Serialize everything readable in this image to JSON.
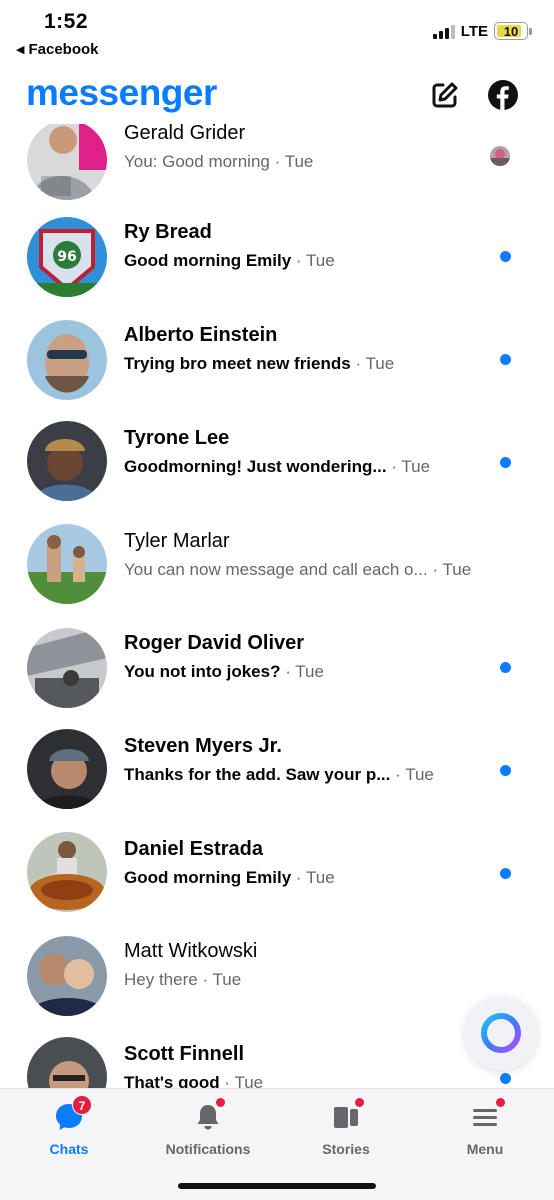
{
  "status_bar": {
    "time": "1:52",
    "back_label": "Facebook",
    "network": "LTE",
    "battery": "10",
    "signal_bars": 3,
    "battery_level_percent": 10
  },
  "header": {
    "title": "messenger",
    "compose_icon": "compose-icon",
    "facebook_icon": "facebook-icon"
  },
  "colors": {
    "accent": "#0a7cff",
    "unread_dot": "#0a7cff",
    "badge": "#e41e3f",
    "secondary_text": "#65676b"
  },
  "chats": [
    {
      "name": "Gerald Grider",
      "message": "You: Good morning",
      "time": "Tue",
      "unread": false,
      "indicator": "seen-avatar"
    },
    {
      "name": "Ry Bread",
      "message": "Good morning Emily",
      "time": "Tue",
      "unread": true,
      "indicator": "unread-dot"
    },
    {
      "name": "Alberto Einstein",
      "message": "Trying bro meet new friends",
      "time": "Tue",
      "unread": true,
      "indicator": "unread-dot"
    },
    {
      "name": "Tyrone Lee",
      "message": "Goodmorning! Just wondering...",
      "time": "Tue",
      "unread": true,
      "indicator": "unread-dot"
    },
    {
      "name": "Tyler Marlar",
      "message": "You can now message and call each o...",
      "time": "Tue",
      "unread": false,
      "indicator": "none"
    },
    {
      "name": "Roger David Oliver",
      "message": "You not into jokes?",
      "time": "Tue",
      "unread": true,
      "indicator": "unread-dot"
    },
    {
      "name": "Steven Myers Jr.",
      "message": "Thanks for the add. Saw your p...",
      "time": "Tue",
      "unread": true,
      "indicator": "unread-dot"
    },
    {
      "name": "Daniel Estrada",
      "message": "Good morning Emily",
      "time": "Tue",
      "unread": true,
      "indicator": "unread-dot"
    },
    {
      "name": "Matt Witkowski",
      "message": "Hey there",
      "time": "Tue",
      "unread": false,
      "indicator": "none"
    },
    {
      "name": "Scott Finnell",
      "message": "That's good",
      "time": "Tue",
      "unread": true,
      "indicator": "unread-dot"
    }
  ],
  "ai_button_icon": "meta-ai-ring-icon",
  "tabs": [
    {
      "label": "Chats",
      "icon": "chat-bubble-icon",
      "active": true,
      "badge": "7"
    },
    {
      "label": "Notifications",
      "icon": "bell-icon",
      "active": false,
      "dot": true
    },
    {
      "label": "Stories",
      "icon": "stories-icon",
      "active": false,
      "dot": true
    },
    {
      "label": "Menu",
      "icon": "menu-icon",
      "active": false,
      "dot": true
    }
  ]
}
